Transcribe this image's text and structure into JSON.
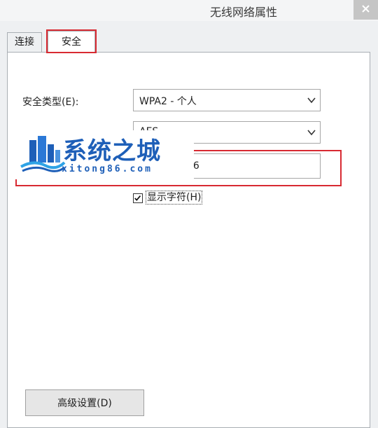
{
  "window": {
    "title": "无线网络属性"
  },
  "tabs": [
    {
      "label": "连接",
      "selected": false
    },
    {
      "label": "安全",
      "selected": true
    }
  ],
  "security": {
    "security_type_label": "安全类型(E):",
    "security_type_value": "WPA2 - 个人",
    "encryption_type_value": "AES",
    "key_partial_visible": "56",
    "show_chars_label": "显示字符(H)",
    "show_chars_checked": true
  },
  "advanced_button_label": "高级设置(D)",
  "watermark": {
    "brand": "系统之城",
    "domain": "xitong86.com"
  },
  "colors": {
    "highlight": "#d82a32",
    "brand": "#1e5fb8"
  },
  "icons": [
    "close-icon",
    "chevron-down-icon",
    "checkmark-icon",
    "logo-icon"
  ]
}
